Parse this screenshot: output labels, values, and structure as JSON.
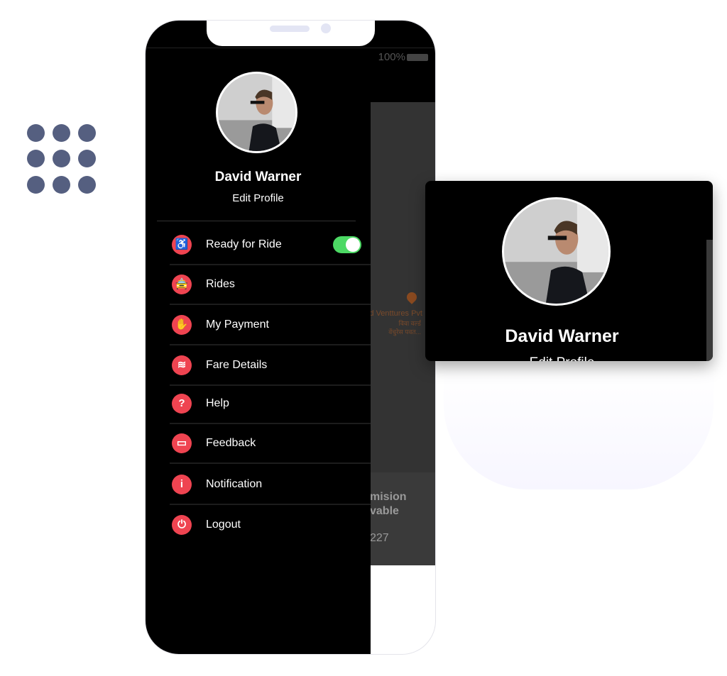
{
  "status_bar": {
    "battery": "100%"
  },
  "profile": {
    "name": "David Warner",
    "edit_label": "Edit Profile"
  },
  "menu": [
    {
      "label": "Ready for Ride",
      "icon": "driver-seat-icon",
      "toggle": true
    },
    {
      "label": "Rides",
      "icon": "car-icon"
    },
    {
      "label": "My Payment",
      "icon": "payment-hand-icon"
    },
    {
      "label": "Fare Details",
      "icon": "coins-icon"
    },
    {
      "label": "Help",
      "icon": "question-icon"
    },
    {
      "label": "Feedback",
      "icon": "chat-icon"
    },
    {
      "label": "Notification",
      "icon": "info-icon"
    },
    {
      "label": "Logout",
      "icon": "power-icon"
    }
  ],
  "map": {
    "place_name": "d Venttures Pvt",
    "place_line2": "विवा वर्ल्ड",
    "place_line3": "वेंचुरेस पवत...",
    "commission_line1": "mision",
    "commission_line2": "vable",
    "amount": "227"
  },
  "popup": {
    "name": "David Warner",
    "edit_label": "Edit Profile"
  },
  "colors": {
    "accent": "#ef4451",
    "toggle_on": "#4cd964",
    "dots": "#555f80"
  }
}
